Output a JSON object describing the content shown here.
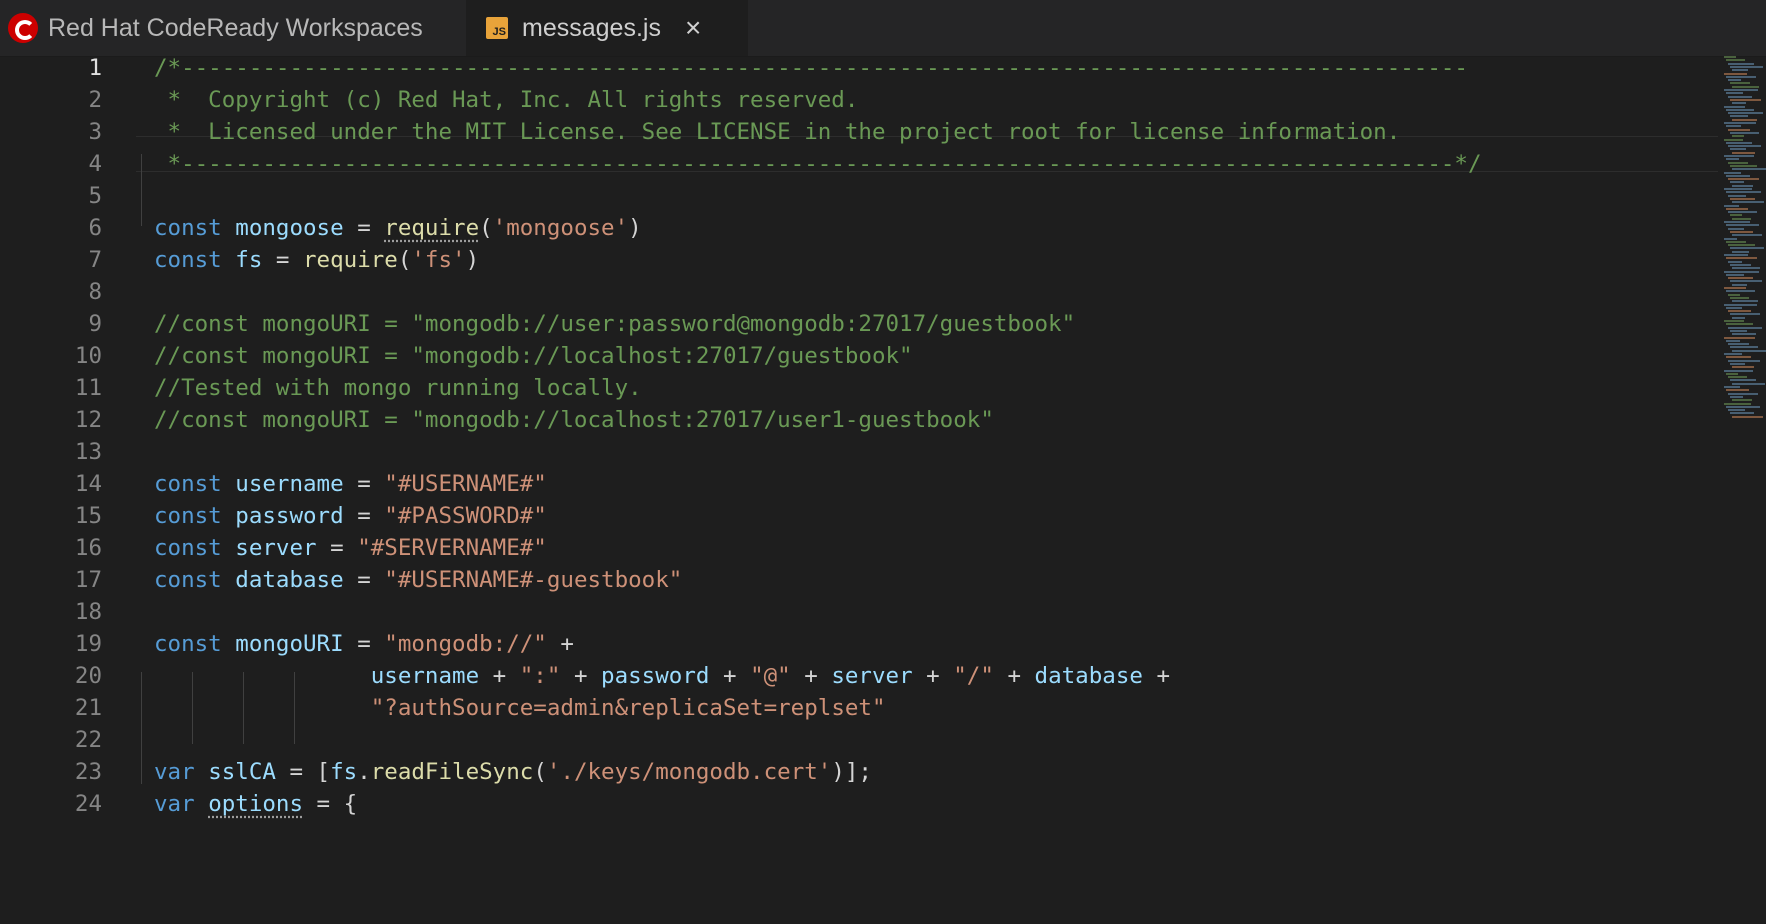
{
  "tabs": {
    "app_title": "Red Hat CodeReady Workspaces",
    "file_tab": {
      "icon_text": "JS",
      "label": "messages.js",
      "close_glyph": "×"
    }
  },
  "editor": {
    "active_line": 1,
    "lines": [
      {
        "n": "1",
        "tokens": [
          {
            "t": "/*-----------------------------------------------------------------------------------------------",
            "c": "comment"
          }
        ]
      },
      {
        "n": "2",
        "tokens": [
          {
            "t": " *  Copyright (c) Red Hat, Inc. All rights reserved.",
            "c": "comment"
          }
        ]
      },
      {
        "n": "3",
        "tokens": [
          {
            "t": " *  Licensed under the MIT License. See LICENSE in the project root for license information.",
            "c": "comment"
          }
        ]
      },
      {
        "n": "4",
        "tokens": [
          {
            "t": " *----------------------------------------------------------------------------------------------*/",
            "c": "comment"
          }
        ]
      },
      {
        "n": "5",
        "tokens": []
      },
      {
        "n": "6",
        "tokens": [
          {
            "t": "const",
            "c": "kw"
          },
          {
            "t": " ",
            "c": "plain"
          },
          {
            "t": "mongoose",
            "c": "var"
          },
          {
            "t": " = ",
            "c": "plain"
          },
          {
            "t": "require",
            "c": "fn",
            "squiggle": true
          },
          {
            "t": "(",
            "c": "plain"
          },
          {
            "t": "'mongoose'",
            "c": "str"
          },
          {
            "t": ")",
            "c": "plain"
          }
        ]
      },
      {
        "n": "7",
        "tokens": [
          {
            "t": "const",
            "c": "kw"
          },
          {
            "t": " ",
            "c": "plain"
          },
          {
            "t": "fs",
            "c": "var"
          },
          {
            "t": " = ",
            "c": "plain"
          },
          {
            "t": "require",
            "c": "fn"
          },
          {
            "t": "(",
            "c": "plain"
          },
          {
            "t": "'fs'",
            "c": "str"
          },
          {
            "t": ")",
            "c": "plain"
          }
        ]
      },
      {
        "n": "8",
        "tokens": []
      },
      {
        "n": "9",
        "tokens": [
          {
            "t": "//const mongoURI = \"mongodb://user:password@mongodb:27017/guestbook\"",
            "c": "comment"
          }
        ]
      },
      {
        "n": "10",
        "tokens": [
          {
            "t": "//const mongoURI = \"mongodb://localhost:27017/guestbook\"",
            "c": "comment"
          }
        ]
      },
      {
        "n": "11",
        "tokens": [
          {
            "t": "//Tested with mongo running locally.",
            "c": "comment"
          }
        ]
      },
      {
        "n": "12",
        "tokens": [
          {
            "t": "//const mongoURI = \"mongodb://localhost:27017/user1-guestbook\"",
            "c": "comment"
          }
        ]
      },
      {
        "n": "13",
        "tokens": []
      },
      {
        "n": "14",
        "tokens": [
          {
            "t": "const",
            "c": "kw"
          },
          {
            "t": " ",
            "c": "plain"
          },
          {
            "t": "username",
            "c": "var"
          },
          {
            "t": " = ",
            "c": "plain"
          },
          {
            "t": "\"#USERNAME#\"",
            "c": "str"
          }
        ]
      },
      {
        "n": "15",
        "tokens": [
          {
            "t": "const",
            "c": "kw"
          },
          {
            "t": " ",
            "c": "plain"
          },
          {
            "t": "password",
            "c": "var"
          },
          {
            "t": " = ",
            "c": "plain"
          },
          {
            "t": "\"#PASSWORD#\"",
            "c": "str"
          }
        ]
      },
      {
        "n": "16",
        "tokens": [
          {
            "t": "const",
            "c": "kw"
          },
          {
            "t": " ",
            "c": "plain"
          },
          {
            "t": "server",
            "c": "var"
          },
          {
            "t": " = ",
            "c": "plain"
          },
          {
            "t": "\"#SERVERNAME#\"",
            "c": "str"
          }
        ]
      },
      {
        "n": "17",
        "tokens": [
          {
            "t": "const",
            "c": "kw"
          },
          {
            "t": " ",
            "c": "plain"
          },
          {
            "t": "database",
            "c": "var"
          },
          {
            "t": " = ",
            "c": "plain"
          },
          {
            "t": "\"#USERNAME#-guestbook\"",
            "c": "str"
          }
        ]
      },
      {
        "n": "18",
        "tokens": []
      },
      {
        "n": "19",
        "tokens": [
          {
            "t": "const",
            "c": "kw"
          },
          {
            "t": " ",
            "c": "plain"
          },
          {
            "t": "mongoURI",
            "c": "var"
          },
          {
            "t": " = ",
            "c": "plain"
          },
          {
            "t": "\"mongodb://\"",
            "c": "str"
          },
          {
            "t": " +",
            "c": "plain"
          }
        ]
      },
      {
        "n": "20",
        "tokens": [
          {
            "t": "                ",
            "c": "plain"
          },
          {
            "t": "username",
            "c": "var"
          },
          {
            "t": " + ",
            "c": "plain"
          },
          {
            "t": "\":\"",
            "c": "str"
          },
          {
            "t": " + ",
            "c": "plain"
          },
          {
            "t": "password",
            "c": "var"
          },
          {
            "t": " + ",
            "c": "plain"
          },
          {
            "t": "\"@\"",
            "c": "str"
          },
          {
            "t": " + ",
            "c": "plain"
          },
          {
            "t": "server",
            "c": "var"
          },
          {
            "t": " + ",
            "c": "plain"
          },
          {
            "t": "\"/\"",
            "c": "str"
          },
          {
            "t": " + ",
            "c": "plain"
          },
          {
            "t": "database",
            "c": "var"
          },
          {
            "t": " +",
            "c": "plain"
          }
        ]
      },
      {
        "n": "21",
        "tokens": [
          {
            "t": "                ",
            "c": "plain"
          },
          {
            "t": "\"?authSource=admin&replicaSet=replset\"",
            "c": "str"
          }
        ]
      },
      {
        "n": "22",
        "tokens": []
      },
      {
        "n": "23",
        "tokens": [
          {
            "t": "var",
            "c": "kw"
          },
          {
            "t": " ",
            "c": "plain"
          },
          {
            "t": "sslCA",
            "c": "var"
          },
          {
            "t": " = [",
            "c": "plain"
          },
          {
            "t": "fs",
            "c": "var"
          },
          {
            "t": ".",
            "c": "plain"
          },
          {
            "t": "readFileSync",
            "c": "fn"
          },
          {
            "t": "(",
            "c": "plain"
          },
          {
            "t": "'./keys/mongodb.cert'",
            "c": "str"
          },
          {
            "t": ")];",
            "c": "plain"
          }
        ]
      },
      {
        "n": "24",
        "tokens": [
          {
            "t": "var",
            "c": "kw"
          },
          {
            "t": " ",
            "c": "plain"
          },
          {
            "t": "options",
            "c": "var",
            "squiggle": true
          },
          {
            "t": " = {",
            "c": "plain"
          }
        ]
      }
    ]
  }
}
